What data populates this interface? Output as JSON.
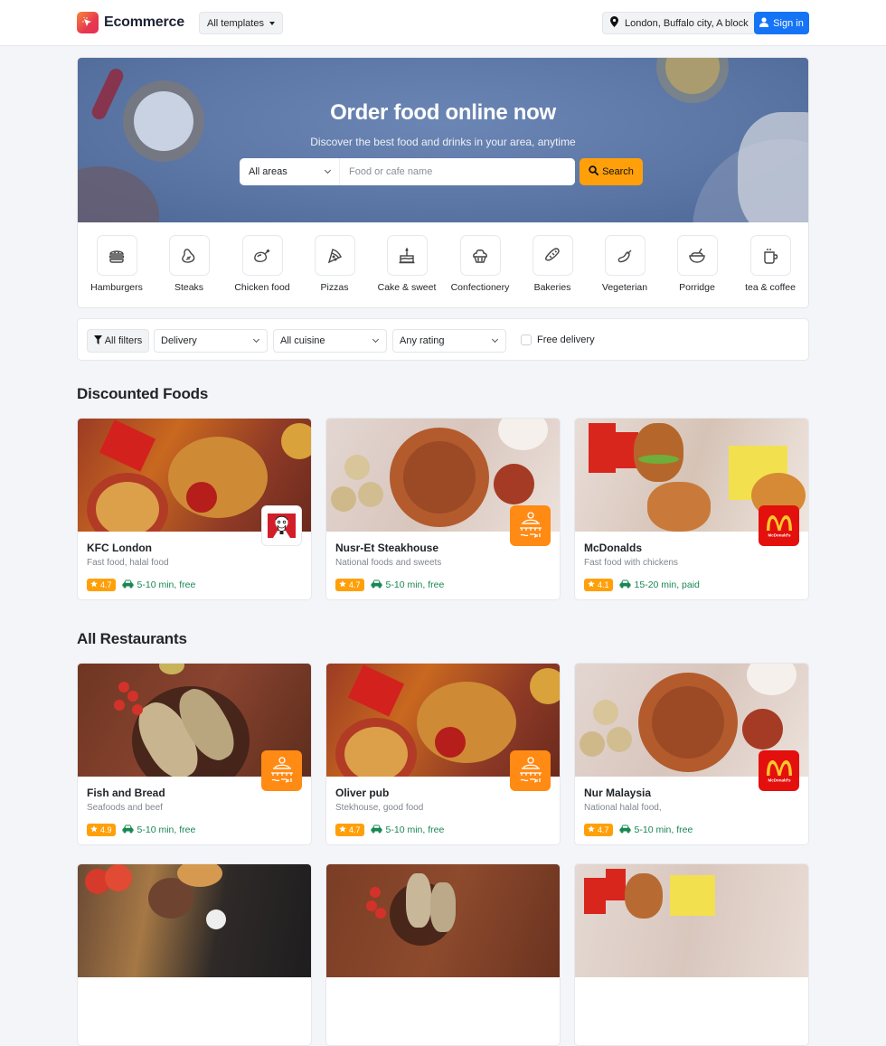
{
  "header": {
    "brand_name": "Ecommerce",
    "templates_label": "All templates",
    "location_label": "London, Buffalo city, A block",
    "signin_label": "Sign in"
  },
  "hero": {
    "title": "Order food online now",
    "subtitle": "Discover the best food and drinks in your area, anytime",
    "area_select": "All areas",
    "search_placeholder": "Food or cafe name",
    "search_button": "Search"
  },
  "categories": [
    {
      "label": "Hamburgers",
      "icon": "burger-icon"
    },
    {
      "label": "Steaks",
      "icon": "steak-icon"
    },
    {
      "label": "Chicken food",
      "icon": "chicken-icon"
    },
    {
      "label": "Pizzas",
      "icon": "pizza-icon"
    },
    {
      "label": "Cake & sweet",
      "icon": "cake-icon"
    },
    {
      "label": "Confectionery",
      "icon": "cupcake-icon"
    },
    {
      "label": "Bakeries",
      "icon": "bread-icon"
    },
    {
      "label": "Vegeterian",
      "icon": "eggplant-icon"
    },
    {
      "label": "Porridge",
      "icon": "bowl-icon"
    },
    {
      "label": "tea & coffee",
      "icon": "cup-icon"
    }
  ],
  "filters": {
    "all_filters": "All filters",
    "delivery": "Delivery",
    "cuisine": "All cuisine",
    "rating": "Any rating",
    "free_delivery": "Free delivery"
  },
  "sections": {
    "discounted_title": "Discounted Foods",
    "all_title": "All Restaurants"
  },
  "discounted": [
    {
      "name": "KFC London",
      "desc": "Fast food, halal food",
      "rating": "4.7",
      "delivery": "5-10 min, free",
      "logo": "kfc",
      "photo": "fries"
    },
    {
      "name": "Nusr-Et Steakhouse",
      "desc": "National foods and sweets",
      "rating": "4.7",
      "delivery": "5-10 min, free",
      "logo": "mandi",
      "photo": "platter"
    },
    {
      "name": "McDonalds",
      "desc": "Fast food with chickens",
      "rating": "4.1",
      "delivery": "15-20 min, paid",
      "logo": "mcdonalds",
      "photo": "burgers"
    }
  ],
  "restaurants": [
    {
      "name": "Fish and Bread",
      "desc": "Seafoods and beef",
      "rating": "4.9",
      "delivery": "5-10 min, free",
      "logo": "mandi",
      "photo": "fish"
    },
    {
      "name": "Oliver pub",
      "desc": "Stekhouse, good food",
      "rating": "4.7",
      "delivery": "5-10 min, free",
      "logo": "mandi",
      "photo": "fries"
    },
    {
      "name": "Nur Malaysia",
      "desc": "National halal food,",
      "rating": "4.7",
      "delivery": "5-10 min, free",
      "logo": "mcdonalds",
      "photo": "platter"
    }
  ],
  "colors": {
    "primary": "#1574f6",
    "accent": "#ffa00a",
    "success": "#198754"
  }
}
